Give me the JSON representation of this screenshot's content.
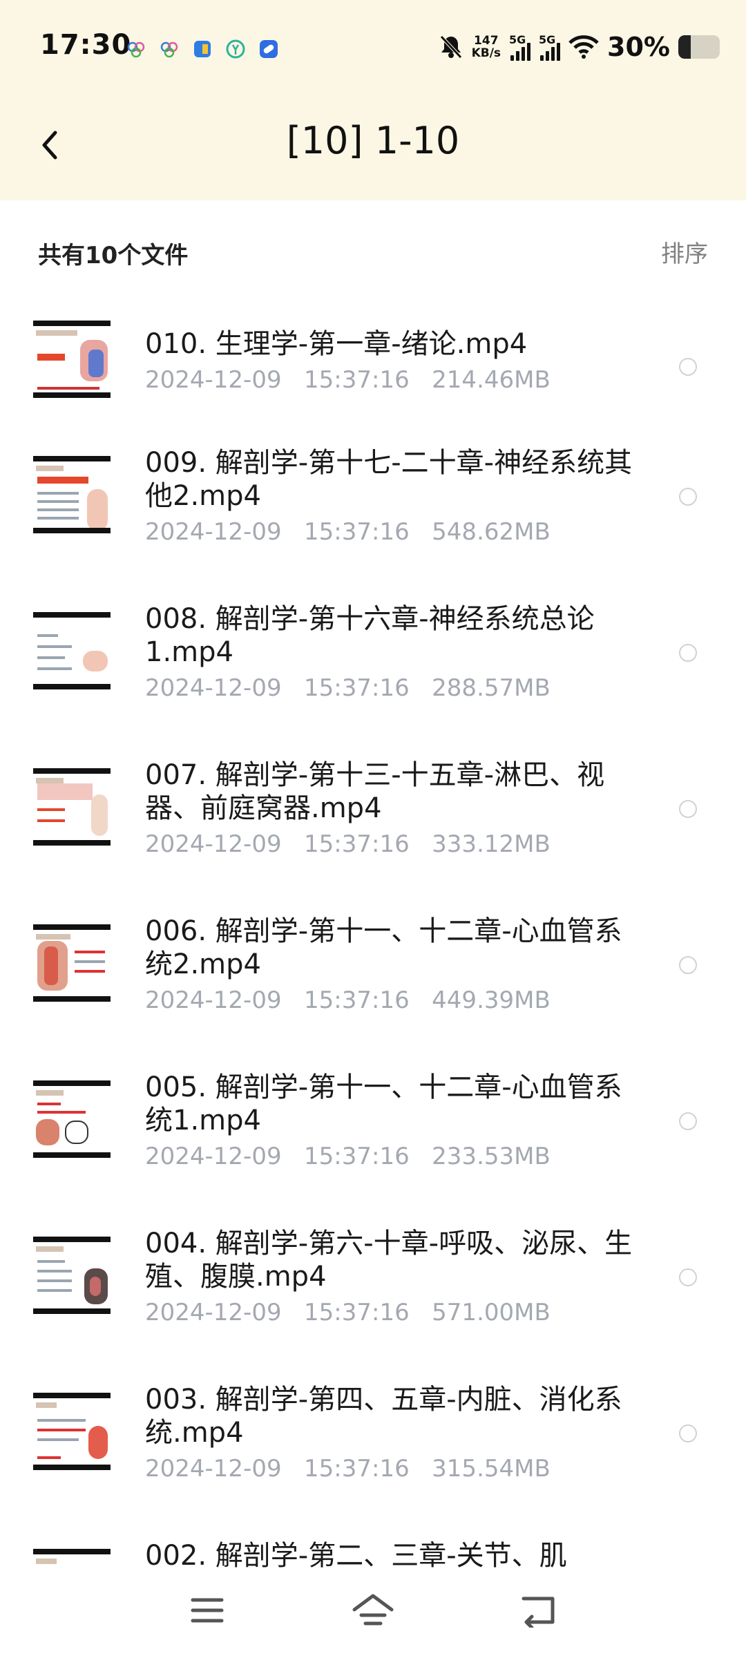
{
  "status_bar": {
    "time": "17:30",
    "notification_icons": [
      "app-icon-blue-circles",
      "app-icon-blue-circles-2",
      "app-icon-blue-yellow",
      "app-icon-green",
      "app-icon-blue-pill"
    ],
    "net_speed_value": "147",
    "net_speed_unit": "KB/s",
    "signal_1_label": "5G",
    "signal_2_label": "5G",
    "battery_percent_label": "30%",
    "battery_level": 0.3
  },
  "header": {
    "title": "[10] 1-10"
  },
  "summary": {
    "file_count_text": "共有10个文件",
    "sort_label": "排序"
  },
  "files": [
    {
      "name": "010.  生理学-第一章-绪论.mp4",
      "date": "2024-12-09",
      "time": "15:37:16",
      "size": "214.46MB"
    },
    {
      "name": "009.  解剖学-第十七-二十章-神经系统其他2.mp4",
      "date": "2024-12-09",
      "time": "15:37:16",
      "size": "548.62MB"
    },
    {
      "name": "008.  解剖学-第十六章-神经系统总论1.mp4",
      "date": "2024-12-09",
      "time": "15:37:16",
      "size": "288.57MB"
    },
    {
      "name": "007.  解剖学-第十三-十五章-淋巴、视器、前庭窝器.mp4",
      "date": "2024-12-09",
      "time": "15:37:16",
      "size": "333.12MB"
    },
    {
      "name": "006.  解剖学-第十一、十二章-心血管系统2.mp4",
      "date": "2024-12-09",
      "time": "15:37:16",
      "size": "449.39MB"
    },
    {
      "name": "005.  解剖学-第十一、十二章-心血管系统1.mp4",
      "date": "2024-12-09",
      "time": "15:37:16",
      "size": "233.53MB"
    },
    {
      "name": "004.  解剖学-第六-十章-呼吸、泌尿、生殖、腹膜.mp4",
      "date": "2024-12-09",
      "time": "15:37:16",
      "size": "571.00MB"
    },
    {
      "name": "003.  解剖学-第四、五章-内脏、消化系统.mp4",
      "date": "2024-12-09",
      "time": "15:37:16",
      "size": "315.54MB"
    },
    {
      "name": "002.  解剖学-第二、三章-关节、肌",
      "date": "",
      "time": "",
      "size": ""
    }
  ],
  "nav": {
    "icons": [
      "menu-icon",
      "home-icon",
      "back-nav-icon"
    ]
  }
}
